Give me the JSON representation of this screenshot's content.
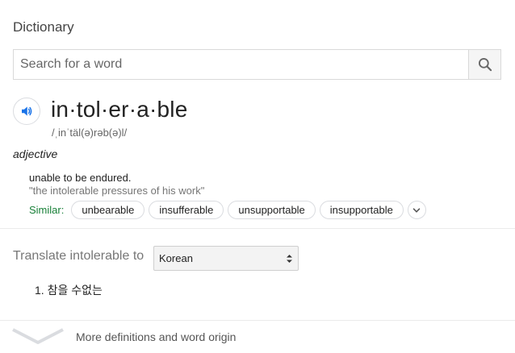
{
  "title": "Dictionary",
  "search": {
    "placeholder": "Search for a word",
    "value": "",
    "icon": "search-icon"
  },
  "entry": {
    "speaker_icon": "speaker-icon",
    "word": "in·tol·er·a·ble",
    "phonetic": "/ˌinˈtäl(ə)rəb(ə)l/",
    "part_of_speech": "adjective",
    "definition": "unable to be endured.",
    "example": "\"the intolerable pressures of his work\"",
    "similar_label": "Similar:",
    "similar": [
      "unbearable",
      "insufferable",
      "unsupportable",
      "insupportable"
    ],
    "expand_icon": "chevron-down-icon"
  },
  "translate": {
    "label": "Translate intolerable to",
    "language": "Korean",
    "results": [
      "1. 참을 수없는"
    ]
  },
  "footer": {
    "more_label": "More definitions and word origin",
    "chevron_icon": "chevron-down-icon"
  },
  "colors": {
    "accent_blue": "#1a73e8",
    "similar_green": "#188038"
  }
}
